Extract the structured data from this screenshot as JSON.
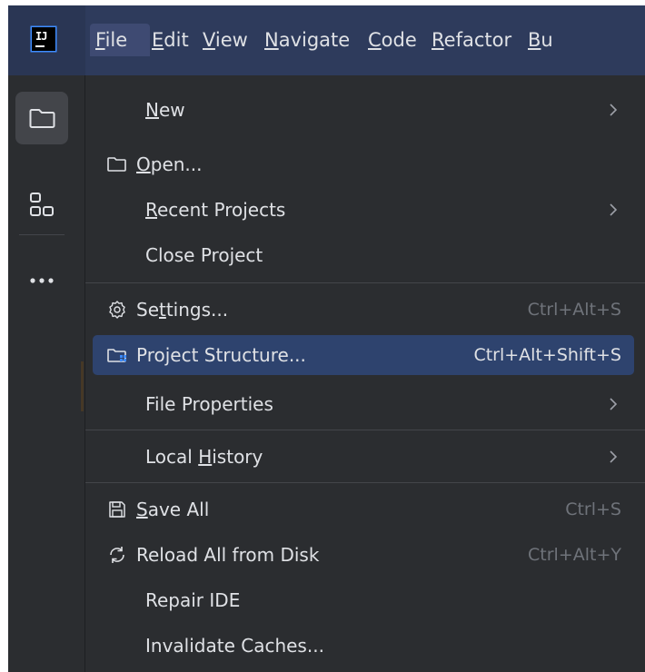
{
  "window": {
    "logo_text": "IJ"
  },
  "menubar": {
    "items": [
      {
        "label": "File",
        "mnemonic": "F"
      },
      {
        "label": "Edit",
        "mnemonic": "E"
      },
      {
        "label": "View",
        "mnemonic": "V"
      },
      {
        "label": "Navigate",
        "mnemonic": "N"
      },
      {
        "label": "Code",
        "mnemonic": "C"
      },
      {
        "label": "Refactor",
        "mnemonic": "R"
      },
      {
        "label": "Bu",
        "mnemonic": "B"
      }
    ],
    "active": "File"
  },
  "toolwindow_bar": {
    "buttons": [
      {
        "icon": "folder-icon",
        "selected": true
      },
      {
        "icon": "structure-icon",
        "selected": false
      },
      {
        "icon": "more-icon",
        "selected": false
      }
    ]
  },
  "file_menu": {
    "items": [
      {
        "label": "New",
        "icon": null,
        "shortcut": "",
        "submenu": true
      },
      {
        "label": "Open...",
        "icon": "folder-icon",
        "shortcut": "",
        "submenu": false
      },
      {
        "label": "Recent Projects",
        "icon": null,
        "shortcut": "",
        "submenu": true
      },
      {
        "label": "Close Project",
        "icon": null,
        "shortcut": "",
        "submenu": false
      },
      {
        "label": "Settings...",
        "icon": "gear-icon",
        "shortcut": "Ctrl+Alt+S",
        "submenu": false
      },
      {
        "label": "Project Structure...",
        "icon": "project-structure-icon",
        "shortcut": "Ctrl+Alt+Shift+S",
        "submenu": false,
        "highlighted": true
      },
      {
        "label": "File Properties",
        "icon": null,
        "shortcut": "",
        "submenu": true
      },
      {
        "label": "Local History",
        "icon": null,
        "shortcut": "",
        "submenu": true
      },
      {
        "label": "Save All",
        "icon": "save-icon",
        "shortcut": "Ctrl+S",
        "submenu": false
      },
      {
        "label": "Reload All from Disk",
        "icon": "reload-icon",
        "shortcut": "Ctrl+Alt+Y",
        "submenu": false
      },
      {
        "label": "Repair IDE",
        "icon": null,
        "shortcut": "",
        "submenu": false
      },
      {
        "label": "Invalidate Caches...",
        "icon": null,
        "shortcut": "",
        "submenu": false
      }
    ]
  },
  "colors": {
    "menubar_bg": "#2e3b5c",
    "menu_bg": "#2b2d30",
    "highlight": "#2e436e",
    "text": "#dfe1e5",
    "shortcut_text": "#6f737a",
    "accent": "#3d8bfd"
  }
}
